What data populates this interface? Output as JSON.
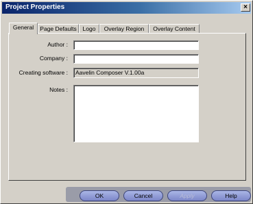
{
  "window": {
    "title": "Project Properties",
    "close_label": "×"
  },
  "tabs": [
    {
      "label": "General",
      "active": true
    },
    {
      "label": "Page Defaults",
      "active": false
    },
    {
      "label": "Logo",
      "active": false
    },
    {
      "label": "Overlay Region",
      "active": false
    },
    {
      "label": "Overlay Content",
      "active": false
    }
  ],
  "form": {
    "author": {
      "label": "Author :",
      "value": ""
    },
    "company": {
      "label": "Company :",
      "value": ""
    },
    "creating_software": {
      "label": "Creating software :",
      "value": "Aavelin Composer V.1.00a"
    },
    "notes": {
      "label": "Notes :",
      "value": ""
    }
  },
  "buttons": {
    "ok": "OK",
    "cancel": "Cancel",
    "apply": "Apply",
    "help": "Help"
  }
}
